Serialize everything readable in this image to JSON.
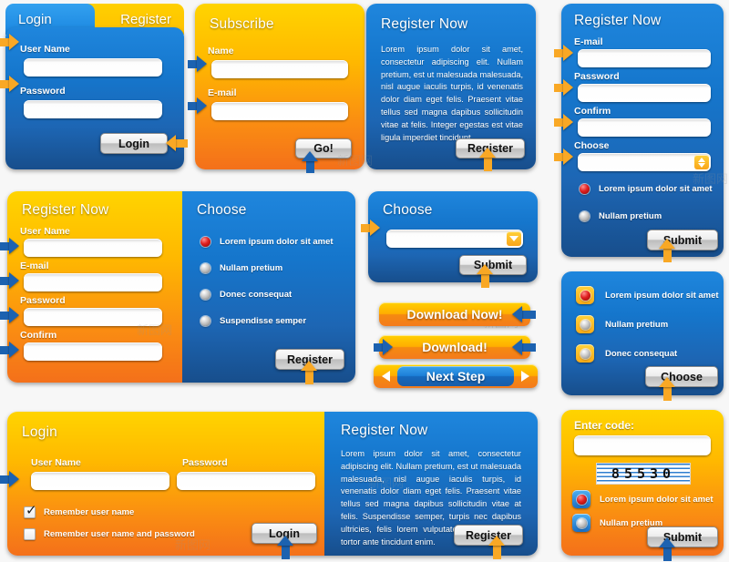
{
  "background": "#f7f7f7",
  "colors": {
    "blue": "#1a6fc4",
    "orange": "#f79a1b",
    "yellow": "#ffd000",
    "radio_selected": "#e02020",
    "arrow_orange": "#f9a825",
    "arrow_blue": "#1c62b0"
  },
  "login_tabs_panel": {
    "tabs": [
      {
        "label": "Login",
        "active": true
      },
      {
        "label": "Register",
        "active": false
      }
    ],
    "fields": [
      {
        "label": "User Name",
        "value": "",
        "placeholder": ""
      },
      {
        "label": "Password",
        "value": "",
        "placeholder": ""
      }
    ],
    "submit_label": "Login"
  },
  "subscribe_panel": {
    "title": "Subscribe",
    "fields": [
      {
        "label": "Name",
        "value": "",
        "placeholder": ""
      },
      {
        "label": "E-mail",
        "value": "",
        "placeholder": ""
      }
    ],
    "submit_label": "Go!"
  },
  "register_text_panel_top": {
    "title": "Register Now",
    "body": "Lorem ipsum dolor sit amet, consectetur adipiscing elit. Nullam pretium, est ut malesuada malesuada, nisl augue iaculis turpis, id venenatis dolor diam eget felis. Praesent vitae tellus sed magna dapibus sollicitudin vitae at felis. Integer egestas est vitae ligula imperdiet tincidunt.",
    "submit_label": "Register"
  },
  "register_form_panel_right": {
    "title": "Register Now",
    "fields": [
      {
        "label": "E-mail",
        "value": "",
        "placeholder": ""
      },
      {
        "label": "Password",
        "value": "",
        "placeholder": ""
      },
      {
        "label": "Confirm",
        "value": "",
        "placeholder": ""
      },
      {
        "label": "Choose",
        "value": "",
        "placeholder": "",
        "widget": "spinner"
      }
    ],
    "options": [
      {
        "label": "Lorem ipsum dolor sit amet",
        "selected": true
      },
      {
        "label": "Nullam pretium",
        "selected": false
      }
    ],
    "submit_label": "Submit"
  },
  "register_form_panel_orange": {
    "title": "Register Now",
    "fields": [
      {
        "label": "User Name",
        "value": "",
        "placeholder": ""
      },
      {
        "label": "E-mail",
        "value": "",
        "placeholder": ""
      },
      {
        "label": "Password",
        "value": "",
        "placeholder": ""
      },
      {
        "label": "Confirm",
        "value": "",
        "placeholder": ""
      }
    ]
  },
  "choose_radio_panel": {
    "title": "Choose",
    "options": [
      {
        "label": "Lorem ipsum dolor sit amet",
        "selected": true
      },
      {
        "label": "Nullam pretium",
        "selected": false
      },
      {
        "label": "Donec consequat",
        "selected": false
      },
      {
        "label": "Suspendisse semper",
        "selected": false
      }
    ],
    "submit_label": "Register"
  },
  "choose_select_panel": {
    "title": "Choose",
    "select": {
      "value": "",
      "placeholder": "",
      "icon": "chevron-down-icon"
    },
    "submit_label": "Submit"
  },
  "action_buttons": [
    {
      "label": "Download Now!",
      "style": "orange",
      "arrows": "right"
    },
    {
      "label": "Download!",
      "style": "orange",
      "arrows": "both"
    },
    {
      "label": "Next Step",
      "style": "blue",
      "arrows": "both-inset"
    }
  ],
  "choose_boxed_panel": {
    "options": [
      {
        "label": "Lorem ipsum dolor sit amet",
        "selected": true
      },
      {
        "label": "Nullam pretium",
        "selected": false
      },
      {
        "label": "Donec consequat",
        "selected": false
      }
    ],
    "submit_label": "Choose"
  },
  "login_wide_panel": {
    "title": "Login",
    "fields": [
      {
        "label": "User Name",
        "value": "",
        "placeholder": ""
      },
      {
        "label": "Password",
        "value": "",
        "placeholder": ""
      }
    ],
    "checkboxes": [
      {
        "label": "Remember user name",
        "checked": true
      },
      {
        "label": "Remember user name and password",
        "checked": false
      }
    ],
    "submit_label": "Login"
  },
  "register_text_panel_bottom": {
    "title": "Register Now",
    "body": "Lorem ipsum dolor sit amet, consectetur adipiscing elit. Nullam pretium, est ut malesuada malesuada, nisl augue iaculis turpis, id venenatis dolor diam eget felis. Praesent vitae tellus sed magna dapibus sollicitudin vitae at felis. Suspendisse semper, turpis nec dapibus ultricies, felis lorem vulputate nisi, id facilisis tortor ante tincidunt enim.",
    "submit_label": "Register"
  },
  "captcha_panel": {
    "title": "Enter code:",
    "input": {
      "value": "",
      "placeholder": ""
    },
    "code": "85530",
    "options": [
      {
        "label": "Lorem ipsum dolor sit amet",
        "selected": true
      },
      {
        "label": "Nullam pretium",
        "selected": false
      }
    ],
    "submit_label": "Submit"
  },
  "watermark": "新图网"
}
